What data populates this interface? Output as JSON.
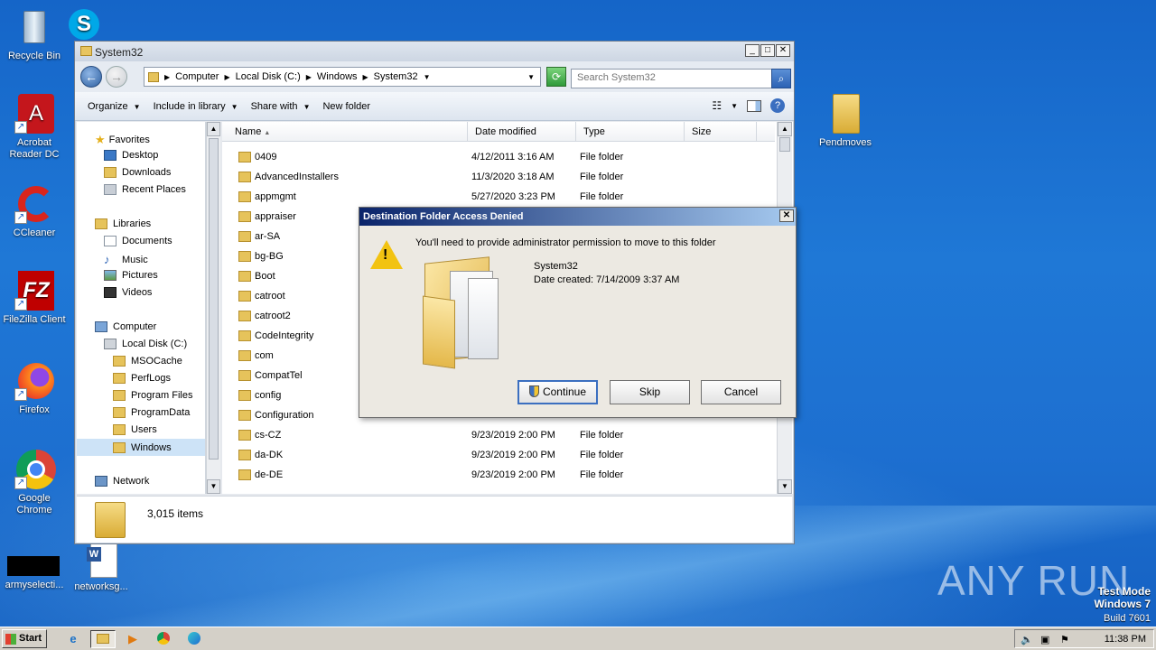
{
  "desktop": {
    "icons": [
      {
        "label": "Recycle Bin"
      },
      {
        "label": "Acrobat Reader DC"
      },
      {
        "label": "CCleaner"
      },
      {
        "label": "FileZilla Client"
      },
      {
        "label": "Firefox"
      },
      {
        "label": "Google Chrome"
      },
      {
        "label": "armyselecti..."
      },
      {
        "label": "networksg..."
      },
      {
        "label": "Pendmoves"
      }
    ]
  },
  "explorer": {
    "title": "System32",
    "breadcrumb": [
      "Computer",
      "Local Disk (C:)",
      "Windows",
      "System32"
    ],
    "search_placeholder": "Search System32",
    "toolbar": {
      "organize": "Organize",
      "include_in_library": "Include in library",
      "share_with": "Share with",
      "new_folder": "New folder"
    },
    "nav": {
      "favorites": "Favorites",
      "desktop": "Desktop",
      "downloads": "Downloads",
      "recent_places": "Recent Places",
      "libraries": "Libraries",
      "documents": "Documents",
      "music": "Music",
      "pictures": "Pictures",
      "videos": "Videos",
      "computer": "Computer",
      "local_disk": "Local Disk (C:)",
      "msocache": "MSOCache",
      "perflogs": "PerfLogs",
      "program_files": "Program Files",
      "program_data": "ProgramData",
      "users": "Users",
      "windows": "Windows",
      "network": "Network"
    },
    "columns": {
      "name": "Name",
      "date_modified": "Date modified",
      "type": "Type",
      "size": "Size"
    },
    "rows": [
      {
        "name": "0409",
        "date": "4/12/2011 3:16 AM",
        "type": "File folder"
      },
      {
        "name": "AdvancedInstallers",
        "date": "11/3/2020 3:18 AM",
        "type": "File folder"
      },
      {
        "name": "appmgmt",
        "date": "5/27/2020 3:23 PM",
        "type": "File folder"
      },
      {
        "name": "appraiser",
        "date": "",
        "type": ""
      },
      {
        "name": "ar-SA",
        "date": "",
        "type": ""
      },
      {
        "name": "bg-BG",
        "date": "",
        "type": ""
      },
      {
        "name": "Boot",
        "date": "",
        "type": ""
      },
      {
        "name": "catroot",
        "date": "",
        "type": ""
      },
      {
        "name": "catroot2",
        "date": "",
        "type": ""
      },
      {
        "name": "CodeIntegrity",
        "date": "",
        "type": ""
      },
      {
        "name": "com",
        "date": "",
        "type": ""
      },
      {
        "name": "CompatTel",
        "date": "",
        "type": ""
      },
      {
        "name": "config",
        "date": "",
        "type": ""
      },
      {
        "name": "Configuration",
        "date": "",
        "type": ""
      },
      {
        "name": "cs-CZ",
        "date": "9/23/2019 2:00 PM",
        "type": "File folder"
      },
      {
        "name": "da-DK",
        "date": "9/23/2019 2:00 PM",
        "type": "File folder"
      },
      {
        "name": "de-DE",
        "date": "9/23/2019 2:00 PM",
        "type": "File folder"
      }
    ],
    "status_count": "3,015 items"
  },
  "dialog": {
    "title": "Destination Folder Access Denied",
    "message": "You'll need to provide administrator permission to move to this folder",
    "folder_name": "System32",
    "date_created": "Date created: 7/14/2009 3:37 AM",
    "continue_label": "Continue",
    "skip_label": "Skip",
    "cancel_label": "Cancel"
  },
  "taskbar": {
    "start_label": "Start",
    "clock": "11:38 PM"
  },
  "watermark": {
    "mode": "Test Mode",
    "os": "Windows 7",
    "build": "Build 7601",
    "brand": "ANY RUN"
  }
}
